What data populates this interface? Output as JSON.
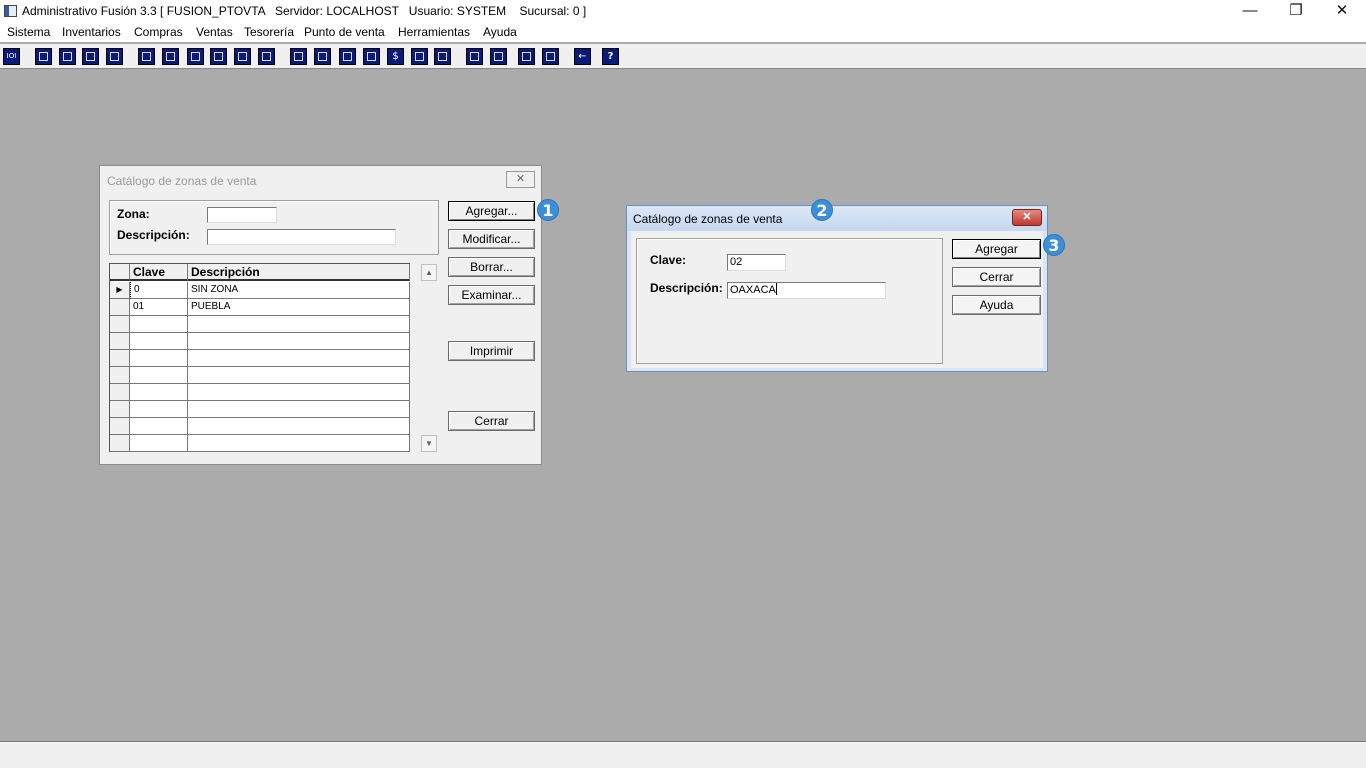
{
  "window": {
    "title": "Administrativo Fusión 3.3 [ FUSION_PTOVTA   Servidor: LOCALHOST   Usuario: SYSTEM    Sucursal: 0 ]",
    "minimize_glyph": "—",
    "restore_glyph": "❐",
    "close_glyph": "✕"
  },
  "menu": [
    "Sistema",
    "Inventarios",
    "Compras",
    "Ventas",
    "Tesorería",
    "Punto de venta",
    "Herramientas",
    "Ayuda"
  ],
  "toolbar": {
    "icons": [
      "ioi-icon",
      "copy-icon",
      "clipboard-icon",
      "exchange-icon",
      "zoom-icon",
      "user-icon",
      "folder-icon",
      "export-icon",
      "printer-icon",
      "document-icon",
      "list-icon",
      "binoculars-icon",
      "folder-open-icon",
      "import-icon",
      "add-icon",
      "dollar-icon",
      "page-icon",
      "table-icon",
      "home-icon",
      "search-icon",
      "refresh-icon",
      "undo-icon",
      "back-arrow-icon",
      "help-icon"
    ],
    "glyphs": {
      "ioi": "IOI",
      "dollar": "$",
      "help": "?",
      "back": "←"
    }
  },
  "catalog_dialog": {
    "title": "Catálogo de zonas de venta",
    "close_glyph": "✕",
    "zona_label": "Zona:",
    "zona_value": "",
    "descripcion_label": "Descripción:",
    "descripcion_value": "",
    "buttons": {
      "agregar": "Agregar...",
      "modificar": "Modificar...",
      "borrar": "Borrar...",
      "examinar": "Examinar...",
      "imprimir": "Imprimir",
      "cerrar": "Cerrar"
    },
    "grid": {
      "columns": [
        "Clave",
        "Descripción"
      ],
      "rows": [
        {
          "clave": "0",
          "descripcion": "SIN ZONA",
          "current": true
        },
        {
          "clave": "01",
          "descripcion": "PUEBLA",
          "current": false
        }
      ],
      "current_row_marker": "▶",
      "scroll_up": "▲",
      "scroll_down": "▼"
    }
  },
  "add_dialog": {
    "title": "Catálogo de zonas de venta",
    "close_glyph": "✕",
    "clave_label": "Clave:",
    "clave_value": "02",
    "descripcion_label": "Descripción:",
    "descripcion_value": "OAXACA",
    "buttons": {
      "agregar": "Agregar",
      "cerrar": "Cerrar",
      "ayuda": "Ayuda"
    }
  },
  "annotations": [
    "1",
    "2",
    "3"
  ],
  "colors": {
    "badge": "#3a8fd6",
    "close_red": "#c9433a",
    "toolbar_icon": "#0a1a78",
    "desktop": "#ababab"
  }
}
